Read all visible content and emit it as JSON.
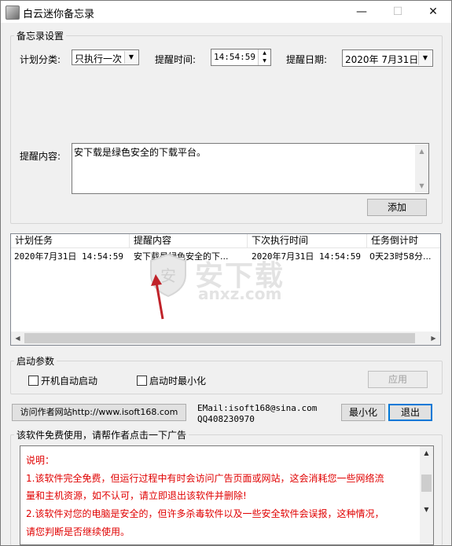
{
  "window": {
    "title": "白云迷你备忘录",
    "minimize_glyph": "—",
    "maximize_glyph": "☐",
    "close_glyph": "✕"
  },
  "settings": {
    "group_label": "备忘录设置",
    "category_label": "计划分类:",
    "category_value": "只执行一次",
    "time_label": "提醒时间:",
    "time_value": "14:54:59",
    "date_label": "提醒日期:",
    "date_value": "2020年 7月31日",
    "content_label": "提醒内容:",
    "content_value": "安下载是绿色安全的下载平台。",
    "add_button": "添加"
  },
  "task_list": {
    "columns": [
      "计划任务",
      "提醒内容",
      "下次执行时间",
      "任务倒计时"
    ],
    "rows": [
      [
        "2020年7月31日 14:54:59",
        "安下载是绿色安全的下...",
        "2020年7月31日 14:54:59",
        "0天23时58分..."
      ]
    ]
  },
  "startup": {
    "group_label": "启动参数",
    "autostart_label": "开机自动启动",
    "minimized_label": "启动时最小化",
    "apply_button": "应用"
  },
  "footer": {
    "visit_button": "访问作者网站http://www.isoft168.com",
    "email_line": "EMail:isoft168@sina.com",
    "qq_line": "QQ408230970",
    "minimize_button": "最小化",
    "exit_button": "退出"
  },
  "ad": {
    "group_label": "该软件免费使用，请帮作者点击一下广告",
    "lines": [
      "说明：",
      "1.该软件完全免费，但运行过程中有时会访问广告页面或网站，这会消耗您一些网络流",
      "量和主机资源，如不认可，请立即退出该软件并删除!",
      "2.该软件对您的电脑是安全的，但许多杀毒软件以及一些安全软件会误报，这种情况，",
      "请您判断是否继续使用。"
    ]
  },
  "watermark": {
    "text_cn": "安下载",
    "text_en": "anxz.com"
  },
  "colors": {
    "ad_text": "#e00000",
    "default_button_border": "#0078d7",
    "annotation_arrow": "#c0232a"
  }
}
